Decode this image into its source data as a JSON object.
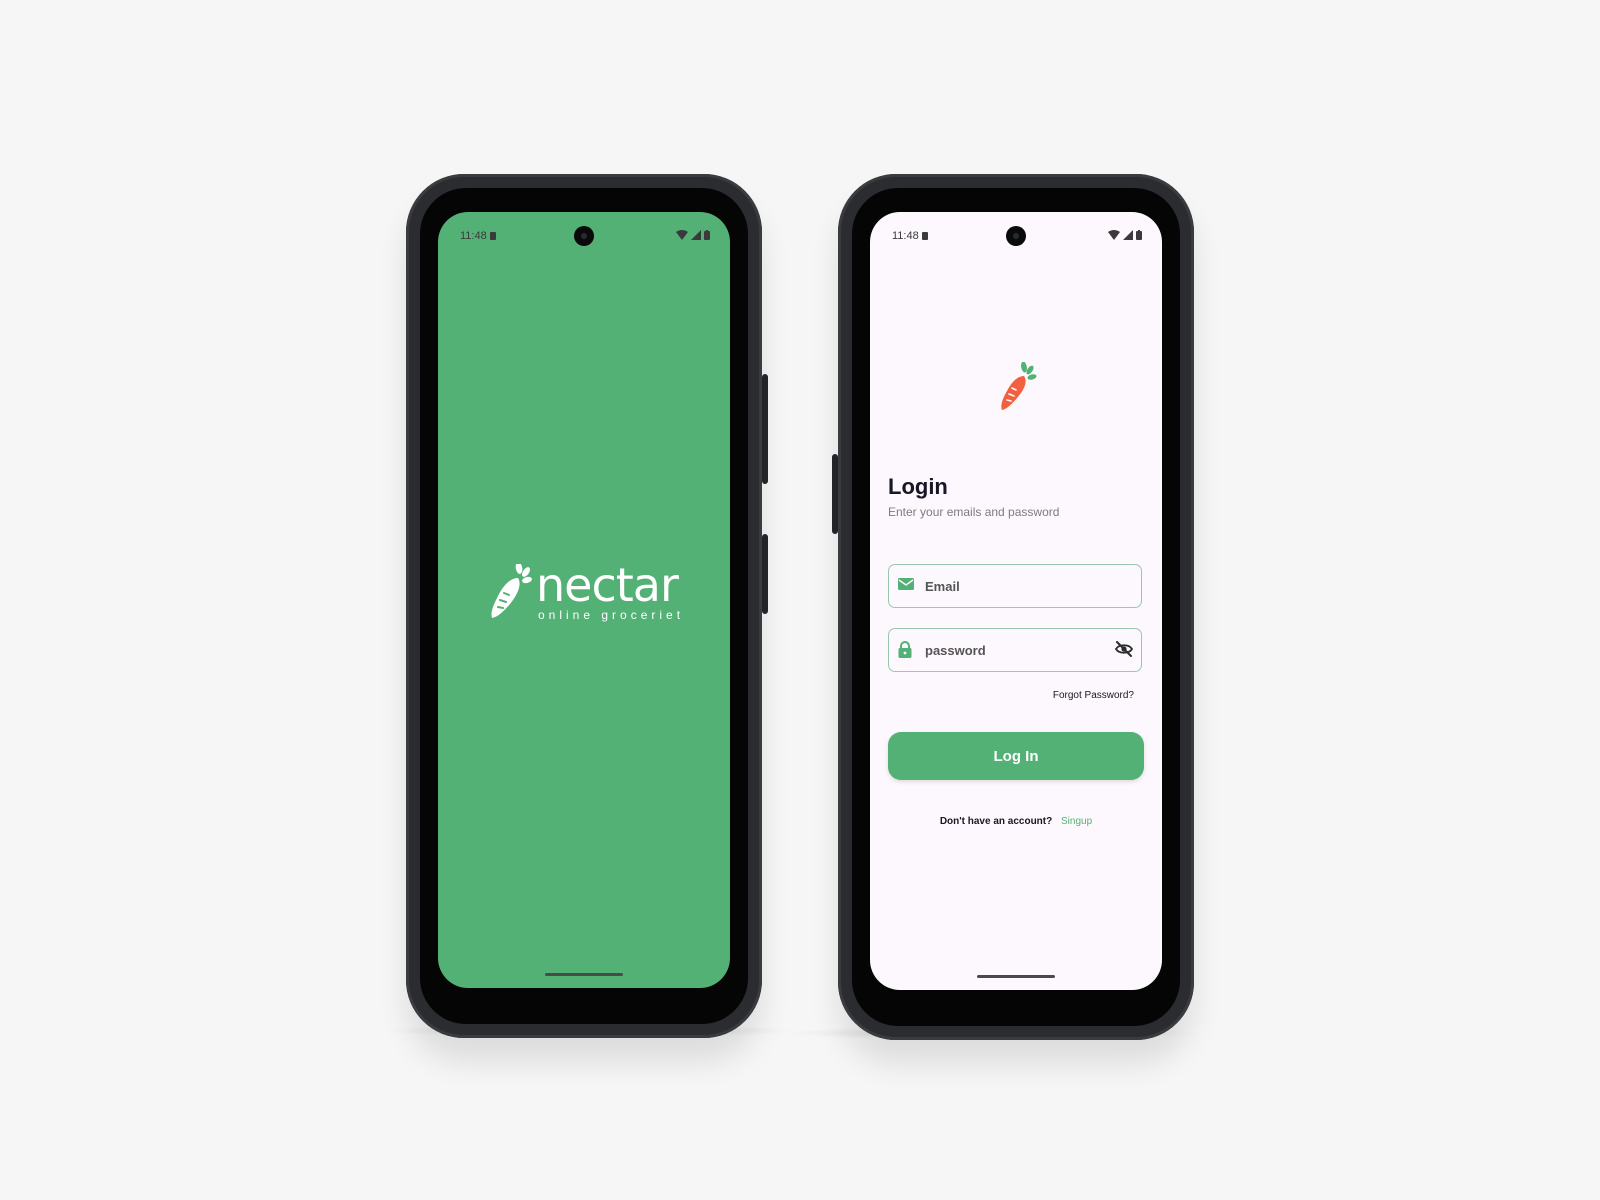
{
  "colors": {
    "background": "#f6f6f6",
    "brand_green": "#53b175",
    "carrot_orange": "#f3603f",
    "login_background": "#fdf8fd"
  },
  "splash_screen": {
    "status_time": "11:48",
    "brand_name": "nectar",
    "tagline": "online groceriet",
    "logo_icon": "carrot-icon"
  },
  "login_screen": {
    "status_time": "11:48",
    "logo_icon": "carrot-icon",
    "title": "Login",
    "subtitle": "Enter your emails and password",
    "email_field": {
      "icon": "mail-icon",
      "placeholder": "Email"
    },
    "password_field": {
      "icon": "lock-icon",
      "placeholder": "password",
      "visibility_icon": "eye-off-icon"
    },
    "forgot_password": "Forgot Password?",
    "login_button": "Log In",
    "signup_prompt": "Don't have an account?",
    "signup_link": "Singup"
  }
}
